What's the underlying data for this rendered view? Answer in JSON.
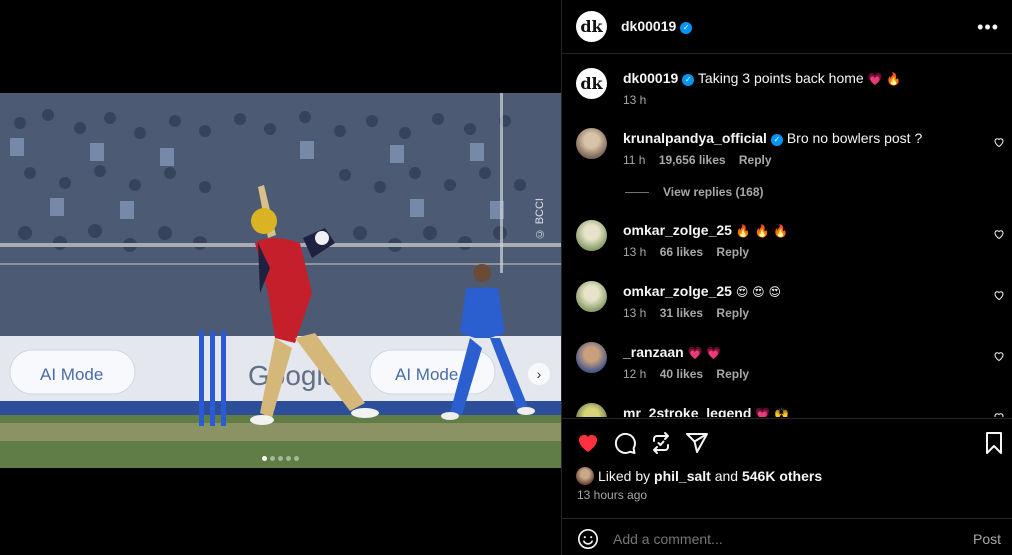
{
  "media": {
    "watermark": "© BCCI",
    "carousel": {
      "total": 5,
      "active": 0
    },
    "next_icon": "chevron-right-icon"
  },
  "post": {
    "author": {
      "username": "dk00019",
      "avatar_text": "dk",
      "verified": true
    },
    "more_icon": "more-horizontal-icon",
    "caption": {
      "username": "dk00019",
      "text": "Taking 3 points back home",
      "emoji": "💗 🔥",
      "time": "13 h"
    },
    "comments": [
      {
        "username": "krunalpandya_official",
        "verified": true,
        "text": "Bro no bowlers post ?",
        "time": "11 h",
        "likes": "19,656 likes",
        "reply": "Reply"
      },
      {
        "username": "omkar_zolge_25",
        "verified": false,
        "text": "🔥 🔥 🔥",
        "time": "13 h",
        "likes": "66 likes",
        "reply": "Reply"
      },
      {
        "username": "omkar_zolge_25",
        "verified": false,
        "text": "😍 😍 😍",
        "time": "13 h",
        "likes": "31 likes",
        "reply": "Reply"
      },
      {
        "username": "_ranzaan",
        "verified": false,
        "text": "💗 💗",
        "time": "12 h",
        "likes": "40 likes",
        "reply": "Reply"
      },
      {
        "username": "mr_2stroke_legend",
        "verified": false,
        "text": "💗 🙌",
        "time": "",
        "likes": "",
        "reply": ""
      }
    ],
    "view_replies": "View replies (168)",
    "actions": {
      "like_color": "#ff3040"
    },
    "liked_by": {
      "prefix": "Liked by",
      "user": "phil_salt",
      "middle": "and",
      "count": "546K others"
    },
    "time_ago": "13 hours ago",
    "comment_placeholder": "Add a comment...",
    "post_label": "Post"
  }
}
